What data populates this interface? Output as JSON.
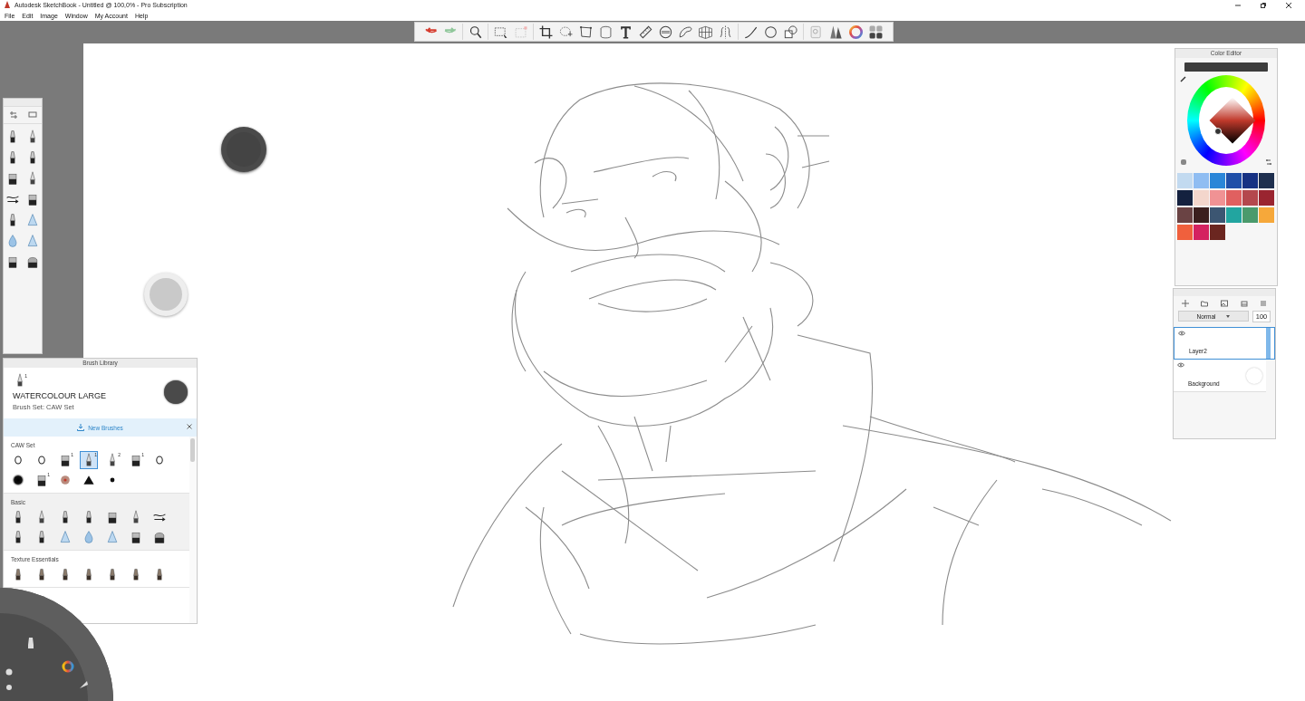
{
  "window": {
    "title": "Autodesk SketchBook - Untitled @ 100,0% - Pro Subscription"
  },
  "menu": [
    {
      "label": "File"
    },
    {
      "label": "Edit"
    },
    {
      "label": "Image"
    },
    {
      "label": "Window"
    },
    {
      "label": "My Account"
    },
    {
      "label": "Help"
    }
  ],
  "tool_palette": {
    "brushes": [
      {
        "kind": "pen",
        "selected": false
      },
      {
        "kind": "fine",
        "selected": false
      },
      {
        "kind": "pen",
        "selected": false
      },
      {
        "kind": "pen",
        "selected": false
      },
      {
        "kind": "block",
        "selected": false
      },
      {
        "kind": "fine",
        "selected": false
      },
      {
        "kind": "wave",
        "selected": false
      },
      {
        "kind": "block",
        "selected": false
      },
      {
        "kind": "pen",
        "selected": false
      },
      {
        "kind": "cone",
        "selected": false
      },
      {
        "kind": "drop",
        "selected": false
      },
      {
        "kind": "cone",
        "selected": false
      },
      {
        "kind": "block",
        "selected": false
      },
      {
        "kind": "eraser",
        "selected": false
      }
    ]
  },
  "brush_library": {
    "title": "Brush Library",
    "current_name": "WATERCOLOUR LARGE",
    "current_set": "Brush Set: CAW Set",
    "current_badge": "1",
    "banner": "New Brushes",
    "sections": [
      {
        "title": "CAW Set",
        "brushes": [
          {
            "kind": "ring",
            "selected": false
          },
          {
            "kind": "ring",
            "selected": false
          },
          {
            "kind": "block",
            "badge": "1",
            "selected": false
          },
          {
            "kind": "fine",
            "badge": "1",
            "selected": true
          },
          {
            "kind": "fine",
            "badge": "2",
            "selected": false
          },
          {
            "kind": "block",
            "badge": "1",
            "selected": false
          },
          {
            "kind": "ring",
            "selected": false
          },
          {
            "kind": "blur",
            "selected": false
          },
          {
            "kind": "block",
            "badge": "1",
            "selected": false
          },
          {
            "kind": "sphere",
            "selected": false
          },
          {
            "kind": "triangle",
            "selected": false
          },
          {
            "kind": "dot",
            "selected": false
          }
        ]
      },
      {
        "title": "Basic",
        "brushes": [
          {
            "kind": "pen",
            "selected": false
          },
          {
            "kind": "fine",
            "selected": false
          },
          {
            "kind": "pen",
            "selected": false
          },
          {
            "kind": "pen",
            "selected": false
          },
          {
            "kind": "block",
            "selected": false
          },
          {
            "kind": "fine",
            "selected": false
          },
          {
            "kind": "wave",
            "selected": false
          },
          {
            "kind": "pen",
            "selected": false
          },
          {
            "kind": "pen",
            "selected": false
          },
          {
            "kind": "cone",
            "selected": false
          },
          {
            "kind": "drop",
            "selected": false
          },
          {
            "kind": "cone",
            "selected": false
          },
          {
            "kind": "block",
            "selected": false
          },
          {
            "kind": "eraser",
            "selected": false
          }
        ]
      },
      {
        "title": "Texture Essentials",
        "brushes": [
          {
            "kind": "texture",
            "selected": false
          },
          {
            "kind": "texture",
            "selected": false
          },
          {
            "kind": "texture",
            "selected": false
          },
          {
            "kind": "texture",
            "selected": false
          },
          {
            "kind": "texture",
            "selected": false
          },
          {
            "kind": "texture",
            "selected": false
          },
          {
            "kind": "texture",
            "selected": false
          }
        ]
      }
    ]
  },
  "color_editor": {
    "title": "Color Editor",
    "swatches": [
      {
        "color": "#c2daf0"
      },
      {
        "color": "#8fbdf2"
      },
      {
        "color": "#2a86d8"
      },
      {
        "color": "#1f4fa8"
      },
      {
        "color": "#163183"
      },
      {
        "color": "#1e2f4e"
      },
      {
        "color": "#14213f"
      },
      {
        "color": "#f3d6cc"
      },
      {
        "color": "#f09294"
      },
      {
        "color": "#e06060"
      },
      {
        "color": "#b4484d"
      },
      {
        "color": "#9a2530"
      },
      {
        "color": "#6a4344"
      },
      {
        "color": "#3b1f1e"
      },
      {
        "color": "#3c5672"
      },
      {
        "color": "#22a5a0"
      },
      {
        "color": "#4a9a6c"
      },
      {
        "color": "#f6a83a"
      },
      {
        "color": "#f0603d"
      },
      {
        "color": "#d42260"
      },
      {
        "color": "#6b2620"
      }
    ]
  },
  "layers": {
    "blend_mode": "Normal",
    "opacity": "100",
    "items": [
      {
        "name": "Layer2",
        "selected": true,
        "visible": true
      },
      {
        "name": "Background",
        "selected": false,
        "visible": true
      }
    ]
  }
}
